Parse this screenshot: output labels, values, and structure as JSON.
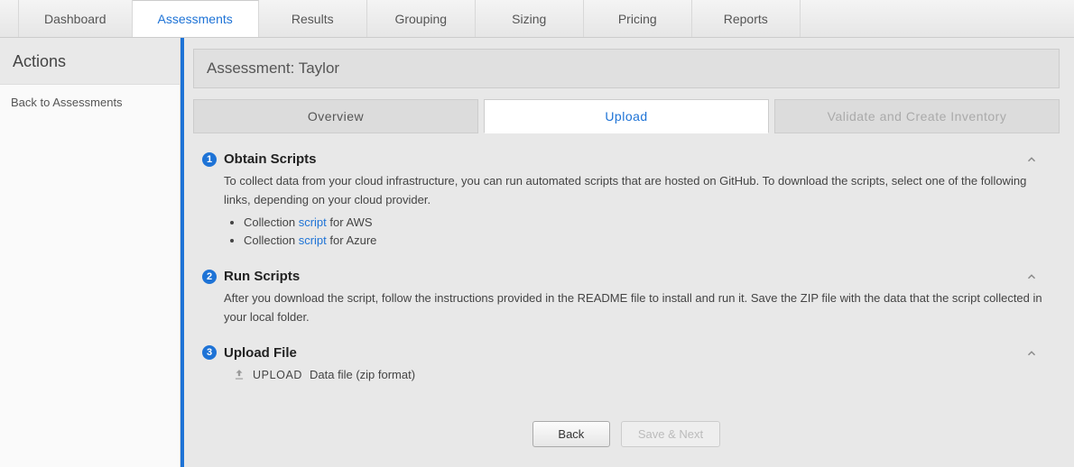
{
  "topnav": [
    {
      "label": "Dashboard",
      "active": false
    },
    {
      "label": "Assessments",
      "active": true
    },
    {
      "label": "Results",
      "active": false
    },
    {
      "label": "Grouping",
      "active": false
    },
    {
      "label": "Sizing",
      "active": false
    },
    {
      "label": "Pricing",
      "active": false
    },
    {
      "label": "Reports",
      "active": false
    }
  ],
  "sidebar": {
    "title": "Actions",
    "back_label": "Back to Assessments"
  },
  "title_bar": "Assessment: Taylor",
  "tabs": {
    "overview": "Overview",
    "upload": "Upload",
    "validate": "Validate and Create Inventory"
  },
  "step1": {
    "num": "1",
    "title": "Obtain Scripts",
    "desc": "To collect data from your cloud infrastructure, you can run automated scripts that are hosted on GitHub. To download the scripts, select one of the following links, depending on your cloud provider.",
    "aws_prefix": "Collection ",
    "aws_link": "script",
    "aws_suffix": " for AWS",
    "azure_prefix": "Collection ",
    "azure_link": "script",
    "azure_suffix": " for Azure"
  },
  "step2": {
    "num": "2",
    "title": "Run Scripts",
    "desc": "After you download the script, follow the instructions provided in the README file to install and run it. Save the ZIP file with the data that the script collected in your local folder."
  },
  "step3": {
    "num": "3",
    "title": "Upload File",
    "upload_label": "UPLOAD",
    "upload_hint": "Data file (zip format)"
  },
  "buttons": {
    "back": "Back",
    "save_next": "Save & Next"
  }
}
